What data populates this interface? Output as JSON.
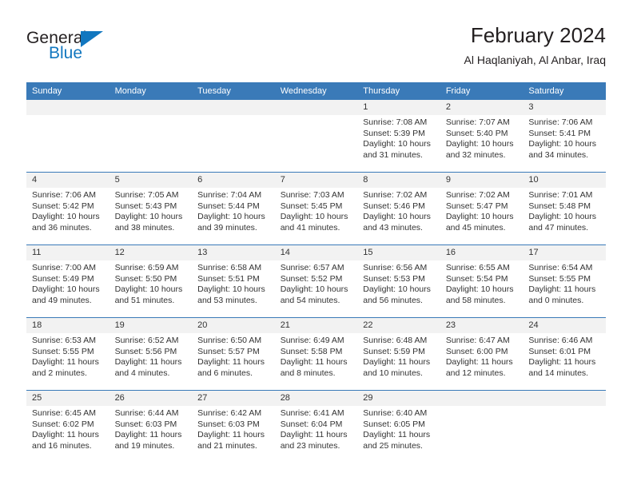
{
  "brand": {
    "name_top": "General",
    "name_bottom": "Blue",
    "triangle_color": "#1277bf"
  },
  "header": {
    "title": "February 2024",
    "subtitle": "Al Haqlaniyah, Al Anbar, Iraq"
  },
  "theme": {
    "header_blue": "#3a7ab8",
    "daynum_bg": "#f2f2f2",
    "text": "#333333"
  },
  "weekdays": [
    "Sunday",
    "Monday",
    "Tuesday",
    "Wednesday",
    "Thursday",
    "Friday",
    "Saturday"
  ],
  "weeks": [
    [
      {
        "day": "",
        "sunrise": "",
        "sunset": "",
        "daylight": ""
      },
      {
        "day": "",
        "sunrise": "",
        "sunset": "",
        "daylight": ""
      },
      {
        "day": "",
        "sunrise": "",
        "sunset": "",
        "daylight": ""
      },
      {
        "day": "",
        "sunrise": "",
        "sunset": "",
        "daylight": ""
      },
      {
        "day": "1",
        "sunrise": "Sunrise: 7:08 AM",
        "sunset": "Sunset: 5:39 PM",
        "daylight": "Daylight: 10 hours and 31 minutes."
      },
      {
        "day": "2",
        "sunrise": "Sunrise: 7:07 AM",
        "sunset": "Sunset: 5:40 PM",
        "daylight": "Daylight: 10 hours and 32 minutes."
      },
      {
        "day": "3",
        "sunrise": "Sunrise: 7:06 AM",
        "sunset": "Sunset: 5:41 PM",
        "daylight": "Daylight: 10 hours and 34 minutes."
      }
    ],
    [
      {
        "day": "4",
        "sunrise": "Sunrise: 7:06 AM",
        "sunset": "Sunset: 5:42 PM",
        "daylight": "Daylight: 10 hours and 36 minutes."
      },
      {
        "day": "5",
        "sunrise": "Sunrise: 7:05 AM",
        "sunset": "Sunset: 5:43 PM",
        "daylight": "Daylight: 10 hours and 38 minutes."
      },
      {
        "day": "6",
        "sunrise": "Sunrise: 7:04 AM",
        "sunset": "Sunset: 5:44 PM",
        "daylight": "Daylight: 10 hours and 39 minutes."
      },
      {
        "day": "7",
        "sunrise": "Sunrise: 7:03 AM",
        "sunset": "Sunset: 5:45 PM",
        "daylight": "Daylight: 10 hours and 41 minutes."
      },
      {
        "day": "8",
        "sunrise": "Sunrise: 7:02 AM",
        "sunset": "Sunset: 5:46 PM",
        "daylight": "Daylight: 10 hours and 43 minutes."
      },
      {
        "day": "9",
        "sunrise": "Sunrise: 7:02 AM",
        "sunset": "Sunset: 5:47 PM",
        "daylight": "Daylight: 10 hours and 45 minutes."
      },
      {
        "day": "10",
        "sunrise": "Sunrise: 7:01 AM",
        "sunset": "Sunset: 5:48 PM",
        "daylight": "Daylight: 10 hours and 47 minutes."
      }
    ],
    [
      {
        "day": "11",
        "sunrise": "Sunrise: 7:00 AM",
        "sunset": "Sunset: 5:49 PM",
        "daylight": "Daylight: 10 hours and 49 minutes."
      },
      {
        "day": "12",
        "sunrise": "Sunrise: 6:59 AM",
        "sunset": "Sunset: 5:50 PM",
        "daylight": "Daylight: 10 hours and 51 minutes."
      },
      {
        "day": "13",
        "sunrise": "Sunrise: 6:58 AM",
        "sunset": "Sunset: 5:51 PM",
        "daylight": "Daylight: 10 hours and 53 minutes."
      },
      {
        "day": "14",
        "sunrise": "Sunrise: 6:57 AM",
        "sunset": "Sunset: 5:52 PM",
        "daylight": "Daylight: 10 hours and 54 minutes."
      },
      {
        "day": "15",
        "sunrise": "Sunrise: 6:56 AM",
        "sunset": "Sunset: 5:53 PM",
        "daylight": "Daylight: 10 hours and 56 minutes."
      },
      {
        "day": "16",
        "sunrise": "Sunrise: 6:55 AM",
        "sunset": "Sunset: 5:54 PM",
        "daylight": "Daylight: 10 hours and 58 minutes."
      },
      {
        "day": "17",
        "sunrise": "Sunrise: 6:54 AM",
        "sunset": "Sunset: 5:55 PM",
        "daylight": "Daylight: 11 hours and 0 minutes."
      }
    ],
    [
      {
        "day": "18",
        "sunrise": "Sunrise: 6:53 AM",
        "sunset": "Sunset: 5:55 PM",
        "daylight": "Daylight: 11 hours and 2 minutes."
      },
      {
        "day": "19",
        "sunrise": "Sunrise: 6:52 AM",
        "sunset": "Sunset: 5:56 PM",
        "daylight": "Daylight: 11 hours and 4 minutes."
      },
      {
        "day": "20",
        "sunrise": "Sunrise: 6:50 AM",
        "sunset": "Sunset: 5:57 PM",
        "daylight": "Daylight: 11 hours and 6 minutes."
      },
      {
        "day": "21",
        "sunrise": "Sunrise: 6:49 AM",
        "sunset": "Sunset: 5:58 PM",
        "daylight": "Daylight: 11 hours and 8 minutes."
      },
      {
        "day": "22",
        "sunrise": "Sunrise: 6:48 AM",
        "sunset": "Sunset: 5:59 PM",
        "daylight": "Daylight: 11 hours and 10 minutes."
      },
      {
        "day": "23",
        "sunrise": "Sunrise: 6:47 AM",
        "sunset": "Sunset: 6:00 PM",
        "daylight": "Daylight: 11 hours and 12 minutes."
      },
      {
        "day": "24",
        "sunrise": "Sunrise: 6:46 AM",
        "sunset": "Sunset: 6:01 PM",
        "daylight": "Daylight: 11 hours and 14 minutes."
      }
    ],
    [
      {
        "day": "25",
        "sunrise": "Sunrise: 6:45 AM",
        "sunset": "Sunset: 6:02 PM",
        "daylight": "Daylight: 11 hours and 16 minutes."
      },
      {
        "day": "26",
        "sunrise": "Sunrise: 6:44 AM",
        "sunset": "Sunset: 6:03 PM",
        "daylight": "Daylight: 11 hours and 19 minutes."
      },
      {
        "day": "27",
        "sunrise": "Sunrise: 6:42 AM",
        "sunset": "Sunset: 6:03 PM",
        "daylight": "Daylight: 11 hours and 21 minutes."
      },
      {
        "day": "28",
        "sunrise": "Sunrise: 6:41 AM",
        "sunset": "Sunset: 6:04 PM",
        "daylight": "Daylight: 11 hours and 23 minutes."
      },
      {
        "day": "29",
        "sunrise": "Sunrise: 6:40 AM",
        "sunset": "Sunset: 6:05 PM",
        "daylight": "Daylight: 11 hours and 25 minutes."
      },
      {
        "day": "",
        "sunrise": "",
        "sunset": "",
        "daylight": ""
      },
      {
        "day": "",
        "sunrise": "",
        "sunset": "",
        "daylight": ""
      }
    ]
  ]
}
